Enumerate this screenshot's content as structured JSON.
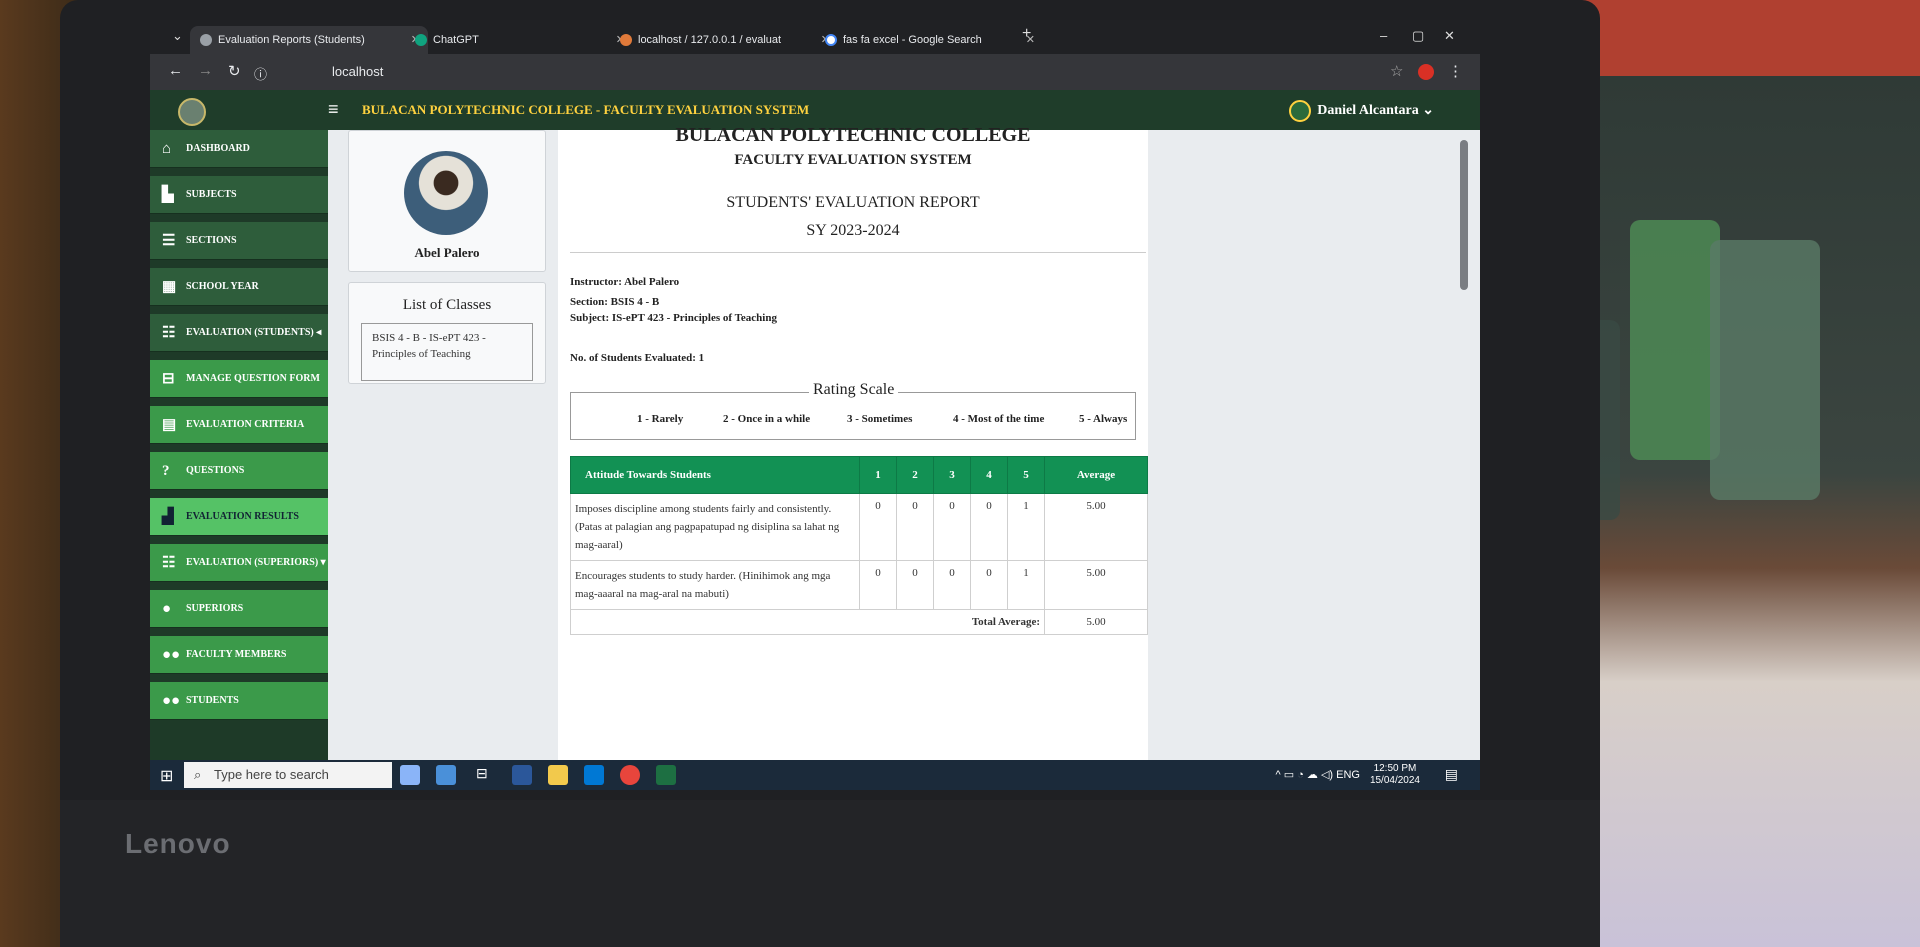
{
  "browser": {
    "tabs": [
      {
        "label": "Evaluation Reports (Students)",
        "active": true
      },
      {
        "label": "ChatGPT",
        "active": false
      },
      {
        "label": "localhost / 127.0.0.1 / evaluat",
        "active": false
      },
      {
        "label": "fas fa excel - Google Search",
        "active": false
      }
    ],
    "url": "localhost"
  },
  "topnav": {
    "title": "BULACAN POLYTECHNIC COLLEGE - FACULTY EVALUATION SYSTEM",
    "user": "Daniel Alcantara"
  },
  "sidebar": {
    "items": [
      {
        "label": "DASHBOARD",
        "icon": "home-icon"
      },
      {
        "label": "SUBJECTS",
        "icon": "book-icon"
      },
      {
        "label": "SECTIONS",
        "icon": "list-icon"
      },
      {
        "label": "SCHOOL YEAR",
        "icon": "calendar-icon"
      },
      {
        "label": "EVALUATION (STUDENTS)",
        "icon": "list-check-icon"
      },
      {
        "label": "MANAGE QUESTION FORM",
        "icon": "form-icon"
      },
      {
        "label": "EVALUATION CRITERIA",
        "icon": "clipboard-icon"
      },
      {
        "label": "QUESTIONS",
        "icon": "question-icon"
      },
      {
        "label": "EVALUATION RESULTS",
        "icon": "chart-icon"
      },
      {
        "label": "EVALUATION (SUPERIORS)",
        "icon": "list-check-icon"
      },
      {
        "label": "SUPERIORS",
        "icon": "user-icon"
      },
      {
        "label": "FACULTY MEMBERS",
        "icon": "users-icon"
      },
      {
        "label": "STUDENTS",
        "icon": "users-icon"
      }
    ]
  },
  "profile": {
    "name": "Abel Palero"
  },
  "classes": {
    "heading": "List of Classes",
    "items": [
      "BSIS 4 - B - IS-ePT 423 - Principles of Teaching"
    ]
  },
  "report": {
    "college": "BULACAN POLYTECHNIC COLLEGE",
    "system": "FACULTY EVALUATION SYSTEM",
    "title": "STUDENTS' EVALUATION REPORT",
    "sy": "SY 2023-2024",
    "instructor": "Instructor: Abel Palero",
    "section": "Section: BSIS 4 - B",
    "subject": "Subject: IS-ePT 423 - Principles of Teaching",
    "evaluated": "No. of Students Evaluated: 1",
    "scale_legend": "Rating Scale",
    "scale": [
      "1 - Rarely",
      "2 - Once in a while",
      "3 - Sometimes",
      "4 - Most of the time",
      "5 - Always"
    ],
    "table": {
      "criteria": "Attitude Towards Students",
      "cols": [
        "1",
        "2",
        "3",
        "4",
        "5",
        "Average"
      ],
      "rows": [
        {
          "question": "Imposes discipline among students fairly and consistently. (Patas at palagian ang pagpapatupad ng disiplina sa lahat ng mag-aaral)",
          "counts": [
            "0",
            "0",
            "0",
            "0",
            "1"
          ],
          "average": "5.00"
        },
        {
          "question": "Encourages students to study harder. (Hinihimok ang mga mag-aaaral na mag-aral na mabuti)",
          "counts": [
            "0",
            "0",
            "0",
            "0",
            "1"
          ],
          "average": "5.00"
        }
      ],
      "total_label": "Total Average:",
      "total_value": "5.00"
    }
  },
  "taskbar": {
    "search_placeholder": "Type here to search",
    "lang": "ENG",
    "time": "12:50 PM",
    "date": "15/04/2024"
  },
  "device": {
    "brand": "Lenovo"
  }
}
